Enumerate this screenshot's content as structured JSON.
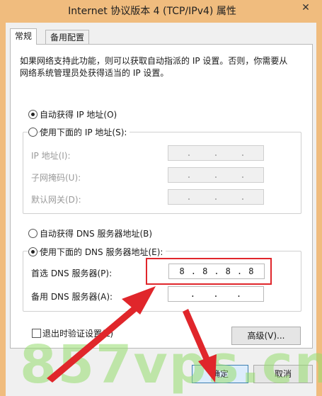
{
  "window": {
    "title": "Internet 协议版本 4 (TCP/IPv4) 属性",
    "close_glyph": "✕"
  },
  "tabs": [
    {
      "label": "常规"
    },
    {
      "label": "备用配置"
    }
  ],
  "description": "如果网络支持此功能，则可以获取自动指派的 IP 设置。否则，你需要从网络系统管理员处获得适当的 IP 设置。",
  "ip_section": {
    "auto_label": "自动获得 IP 地址(O)",
    "manual_label": "使用下面的 IP 地址(S):",
    "auto_selected": true,
    "fields": [
      {
        "label": "IP 地址(I):",
        "value": [
          ".",
          ".",
          "."
        ]
      },
      {
        "label": "子网掩码(U):",
        "value": [
          ".",
          ".",
          "."
        ]
      },
      {
        "label": "默认网关(D):",
        "value": [
          ".",
          ".",
          "."
        ]
      }
    ]
  },
  "dns_section": {
    "auto_label": "自动获得 DNS 服务器地址(B)",
    "manual_label": "使用下面的 DNS 服务器地址(E):",
    "manual_selected": true,
    "preferred": {
      "label": "首选 DNS 服务器(P):",
      "octets": [
        "8",
        "8",
        "8",
        "8"
      ]
    },
    "alternate": {
      "label": "备用 DNS 服务器(A):",
      "octets": [
        "",
        "",
        "",
        ""
      ]
    }
  },
  "validate_label": "退出时验证设置(L)",
  "advanced_label": "高级(V)...",
  "ok_label": "确定",
  "cancel_label": "取消",
  "watermark": "857vps.cn",
  "colors": {
    "titlebar": "#f0bc7e",
    "highlight": "#e0262b",
    "watermark": "#96dc6e"
  }
}
